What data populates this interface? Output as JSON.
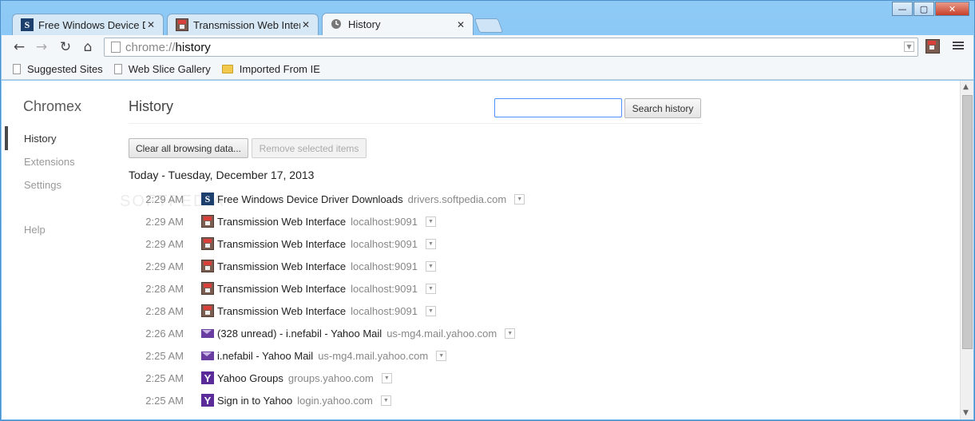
{
  "window": {
    "controls": {
      "minimize": "—",
      "maximize": "▢",
      "close": "✕"
    }
  },
  "tabs": [
    {
      "title": "Free Windows Device Driv",
      "icon": "softpedia-icon",
      "close": "✕"
    },
    {
      "title": "Transmission Web Interfac",
      "icon": "transmission-icon",
      "close": "✕"
    },
    {
      "title": "History",
      "icon": "clock-icon",
      "close": "✕"
    }
  ],
  "toolbar": {
    "back": "←",
    "forward": "→",
    "reload": "↻",
    "home": "⌂",
    "url_scheme": "chrome://",
    "url_path": "history",
    "dropdown": "▼"
  },
  "bookmarks": [
    {
      "label": "Suggested Sites",
      "icon": "page-icon"
    },
    {
      "label": "Web Slice Gallery",
      "icon": "page-icon"
    },
    {
      "label": "Imported From IE",
      "icon": "folder-icon"
    }
  ],
  "sidebar": {
    "title": "Chromex",
    "items": [
      {
        "label": "History",
        "selected": true
      },
      {
        "label": "Extensions",
        "selected": false
      },
      {
        "label": "Settings",
        "selected": false
      },
      {
        "label": "Help",
        "selected": false
      }
    ]
  },
  "main": {
    "title": "History",
    "search_value": "",
    "search_button": "Search history",
    "clear_button": "Clear all browsing data...",
    "remove_button": "Remove selected items",
    "day_heading": "Today - Tuesday, December 17, 2013",
    "more_glyph": "▼",
    "entries": [
      {
        "time": "2:29 AM",
        "icon": "softpedia-icon",
        "title": "Free Windows Device Driver Downloads",
        "domain": "drivers.softpedia.com"
      },
      {
        "time": "2:29 AM",
        "icon": "transmission-icon",
        "title": "Transmission Web Interface",
        "domain": "localhost:9091"
      },
      {
        "time": "2:29 AM",
        "icon": "transmission-icon",
        "title": "Transmission Web Interface",
        "domain": "localhost:9091"
      },
      {
        "time": "2:29 AM",
        "icon": "transmission-icon",
        "title": "Transmission Web Interface",
        "domain": "localhost:9091"
      },
      {
        "time": "2:28 AM",
        "icon": "transmission-icon",
        "title": "Transmission Web Interface",
        "domain": "localhost:9091"
      },
      {
        "time": "2:28 AM",
        "icon": "transmission-icon",
        "title": "Transmission Web Interface",
        "domain": "localhost:9091"
      },
      {
        "time": "2:26 AM",
        "icon": "yahoo-mail-icon",
        "title": "(328 unread) - i.nefabil - Yahoo Mail",
        "domain": "us-mg4.mail.yahoo.com"
      },
      {
        "time": "2:25 AM",
        "icon": "yahoo-mail-icon",
        "title": "i.nefabil - Yahoo Mail",
        "domain": "us-mg4.mail.yahoo.com"
      },
      {
        "time": "2:25 AM",
        "icon": "yahoo-icon",
        "title": "Yahoo Groups",
        "domain": "groups.yahoo.com"
      },
      {
        "time": "2:25 AM",
        "icon": "yahoo-icon",
        "title": "Sign in to Yahoo",
        "domain": "login.yahoo.com"
      }
    ]
  },
  "watermark": "SOFTPEDIA",
  "colors": {
    "frame": "#6db5ee",
    "search_focus": "#4d90fe",
    "yahoo_purple": "#5b2c99",
    "softpedia_blue": "#1c3f6e"
  }
}
